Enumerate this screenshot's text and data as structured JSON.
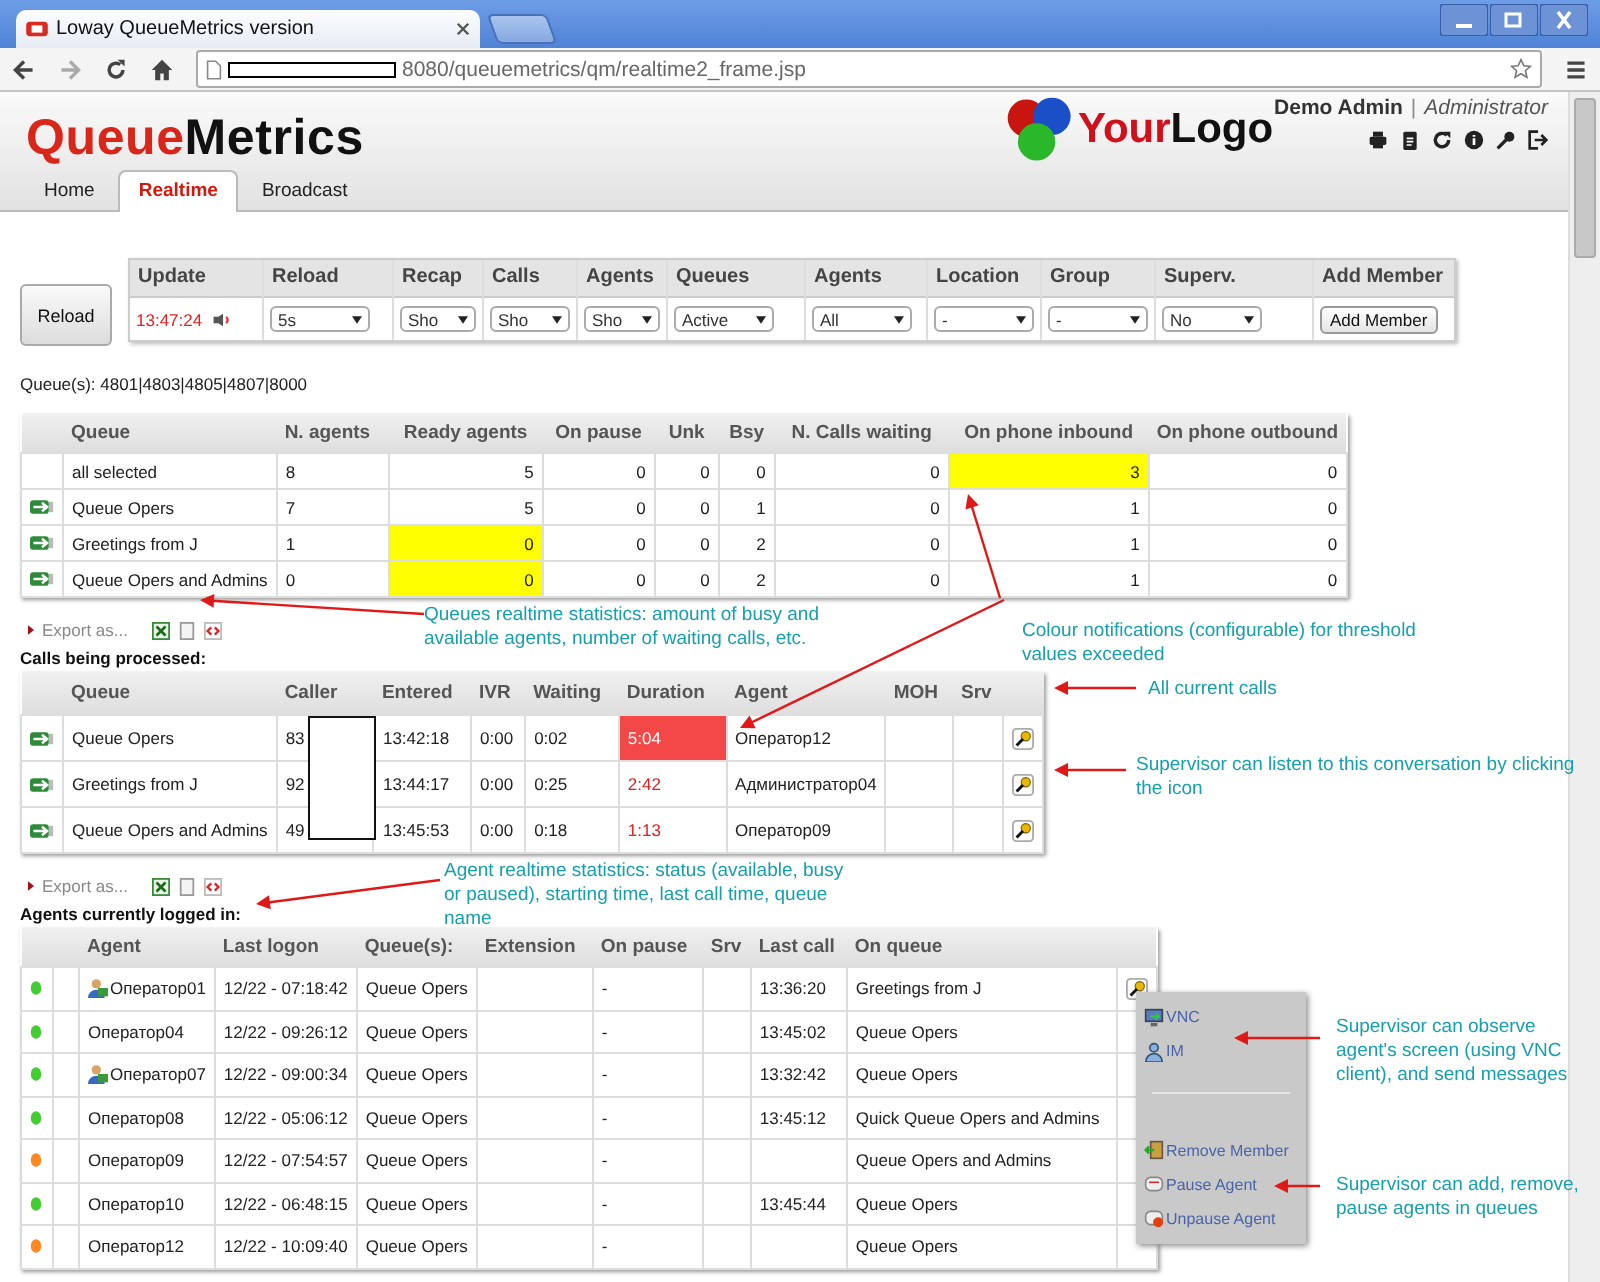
{
  "browser": {
    "tab_title": "Loway QueueMetrics version",
    "url": "8080/queuemetrics/qm/realtime2_frame.jsp"
  },
  "header": {
    "logo_first": "Queue",
    "logo_second": "Metrics",
    "brand_first": "Your",
    "brand_second": "Logo",
    "user": "Demo Admin",
    "separator": "|",
    "role": "Administrator"
  },
  "nav_tabs": [
    {
      "label": "Home",
      "selected": false
    },
    {
      "label": "Realtime",
      "selected": true
    },
    {
      "label": "Broadcast",
      "selected": false
    }
  ],
  "toolbar": {
    "reload_button": "Reload",
    "filters": [
      {
        "label": "Update",
        "kind": "time",
        "value": "13:47:24"
      },
      {
        "label": "Reload",
        "kind": "select",
        "value": "5s"
      },
      {
        "label": "Recap",
        "kind": "select",
        "value": "Sho"
      },
      {
        "label": "Calls",
        "kind": "select",
        "value": "Sho"
      },
      {
        "label": "Agents",
        "kind": "select",
        "value": "Sho"
      },
      {
        "label": "Queues",
        "kind": "select",
        "value": "Active"
      },
      {
        "label": "Agents",
        "kind": "select",
        "value": "All"
      },
      {
        "label": "Location",
        "kind": "select",
        "value": "-"
      },
      {
        "label": "Group",
        "kind": "select",
        "value": "-"
      },
      {
        "label": "Superv.",
        "kind": "select",
        "value": "No"
      },
      {
        "label": "Add Member",
        "kind": "button",
        "value": "Add Member"
      }
    ]
  },
  "queue_line": "Queue(s): 4801|4803|4805|4807|8000",
  "queue_table": {
    "columns": [
      "Queue",
      "N. agents",
      "Ready agents",
      "On pause",
      "Unk",
      "Bsy",
      "N. Calls waiting",
      "On phone inbound",
      "On phone outbound"
    ],
    "rows": [
      {
        "icon": false,
        "cells": [
          {
            "t": "all selected",
            "alert": false
          },
          {
            "t": "8",
            "alert": false
          },
          {
            "t": "5",
            "alert": false
          },
          {
            "t": "0",
            "alert": false
          },
          {
            "t": "0",
            "alert": false
          },
          {
            "t": "0",
            "alert": false
          },
          {
            "t": "0",
            "alert": false
          },
          {
            "t": "3",
            "alert": true
          },
          {
            "t": "0",
            "alert": false
          }
        ]
      },
      {
        "icon": true,
        "cells": [
          {
            "t": "Queue Opers",
            "alert": false
          },
          {
            "t": "7",
            "alert": false
          },
          {
            "t": "5",
            "alert": false
          },
          {
            "t": "0",
            "alert": false
          },
          {
            "t": "0",
            "alert": false
          },
          {
            "t": "1",
            "alert": false
          },
          {
            "t": "0",
            "alert": false
          },
          {
            "t": "1",
            "alert": false
          },
          {
            "t": "0",
            "alert": false
          }
        ]
      },
      {
        "icon": true,
        "cells": [
          {
            "t": "Greetings from J",
            "alert": false
          },
          {
            "t": "1",
            "alert": false
          },
          {
            "t": "0",
            "alert": true
          },
          {
            "t": "0",
            "alert": false
          },
          {
            "t": "0",
            "alert": false
          },
          {
            "t": "2",
            "alert": false
          },
          {
            "t": "0",
            "alert": false
          },
          {
            "t": "1",
            "alert": false
          },
          {
            "t": "0",
            "alert": false
          }
        ]
      },
      {
        "icon": true,
        "cells": [
          {
            "t": "Queue Opers and Admins",
            "alert": false
          },
          {
            "t": "0",
            "alert": false
          },
          {
            "t": "0",
            "alert": true
          },
          {
            "t": "0",
            "alert": false
          },
          {
            "t": "0",
            "alert": false
          },
          {
            "t": "2",
            "alert": false
          },
          {
            "t": "0",
            "alert": false
          },
          {
            "t": "1",
            "alert": false
          },
          {
            "t": "0",
            "alert": false
          }
        ]
      }
    ]
  },
  "calls_section": {
    "export_label": "Export as...",
    "title": "Calls being processed:",
    "columns": [
      "Queue",
      "Caller",
      "Entered",
      "IVR",
      "Waiting",
      "Duration",
      "Agent",
      "MOH",
      "Srv"
    ],
    "rows": [
      {
        "queue": "Queue Opers",
        "caller": "83",
        "entered": "13:42:18",
        "ivr": "0:00",
        "waiting": "0:02",
        "duration": "5:04",
        "alert": true,
        "critical": true,
        "agent": "Оператор12"
      },
      {
        "queue": "Greetings from J",
        "caller": "92",
        "entered": "13:44:17",
        "ivr": "0:00",
        "waiting": "0:25",
        "duration": "2:42",
        "alert": true,
        "critical": false,
        "agent": "Администратор04"
      },
      {
        "queue": "Queue Opers and Admins",
        "caller": "49",
        "entered": "13:45:53",
        "ivr": "0:00",
        "waiting": "0:18",
        "duration": "1:13",
        "alert": true,
        "critical": false,
        "agent": "Оператор09"
      }
    ]
  },
  "agents_section": {
    "export_label": "Export as...",
    "title": "Agents currently logged in:",
    "columns": [
      "Agent",
      "Last logon",
      "Queue(s):",
      "Extension",
      "On pause",
      "Srv",
      "Last call",
      "On queue"
    ],
    "rows": [
      {
        "color": "#44cc33",
        "supervised": true,
        "listen": true,
        "agent": "Оператор01",
        "last_logon": "12/22 - 07:18:42",
        "queues": "Queue Opers",
        "on_pause": "-",
        "last_call": "13:36:20",
        "on_queue": "Greetings from J"
      },
      {
        "color": "#44cc33",
        "supervised": false,
        "listen": false,
        "agent": "Оператор04",
        "last_logon": "12/22 - 09:26:12",
        "queues": "Queue Opers",
        "on_pause": "-",
        "last_call": "13:45:02",
        "on_queue": "Queue Opers"
      },
      {
        "color": "#44cc33",
        "supervised": true,
        "listen": false,
        "agent": "Оператор07",
        "last_logon": "12/22 - 09:00:34",
        "queues": "Queue Opers",
        "on_pause": "-",
        "last_call": "13:32:42",
        "on_queue": "Queue Opers"
      },
      {
        "color": "#44cc33",
        "supervised": false,
        "listen": false,
        "agent": "Оператор08",
        "last_logon": "12/22 - 05:06:12",
        "queues": "Queue Opers",
        "on_pause": "-",
        "last_call": "13:45:12",
        "on_queue": "Quick Queue Opers and Admins"
      },
      {
        "color": "#ff8822",
        "supervised": false,
        "listen": false,
        "agent": "Оператор09",
        "last_logon": "12/22 - 07:54:57",
        "queues": "Queue Opers",
        "on_pause": "-",
        "on_queue": "Queue Opers and Admins"
      },
      {
        "color": "#44cc33",
        "supervised": false,
        "listen": false,
        "agent": "Оператор10",
        "last_logon": "12/22 - 06:48:15",
        "queues": "Queue Opers",
        "on_pause": "-",
        "last_call": "13:45:44",
        "on_queue": "Queue Opers"
      },
      {
        "color": "#ff8822",
        "supervised": false,
        "listen": false,
        "agent": "Оператор12",
        "last_logon": "12/22 - 10:09:40",
        "queues": "Queue Opers",
        "on_pause": "-",
        "on_queue": "Queue Opers"
      }
    ]
  },
  "context_menu": {
    "items": [
      {
        "kind": "vnc",
        "label": "VNC"
      },
      {
        "kind": "im",
        "label": "IM"
      },
      {
        "kind": "separator"
      },
      {
        "kind": "remove",
        "label": "Remove Member"
      },
      {
        "kind": "pause",
        "label": "Pause Agent"
      },
      {
        "kind": "unpause",
        "label": "Unpause Agent"
      }
    ]
  },
  "annotations": [
    {
      "text": "Queues realtime statistics: amount of busy and available agents, number of waiting calls, etc."
    },
    {
      "text": "Colour notifications (configurable) for threshold values exceeded"
    },
    {
      "text": "All current calls"
    },
    {
      "text": "Supervisor can listen to this conversation by clicking the icon"
    },
    {
      "text": "Agent realtime statistics: status (available, busy or paused), starting time,  last call time,  queue name"
    },
    {
      "text": "Supervisor can observe agent's screen (using VNC client), and send messages"
    },
    {
      "text": "Supervisor can add, remove, pause agents in queues"
    }
  ]
}
